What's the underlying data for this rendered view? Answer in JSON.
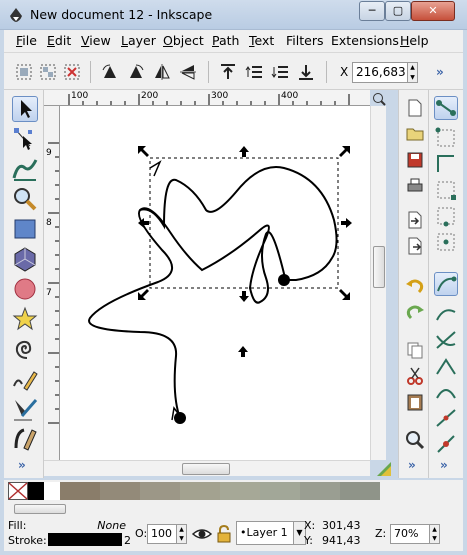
{
  "window": {
    "title": "New document 12 - Inkscape",
    "min_glyph": "─",
    "max_glyph": "▢",
    "close_glyph": "✕"
  },
  "menu": [
    {
      "key": "F",
      "rest": "ile"
    },
    {
      "key": "E",
      "rest": "dit"
    },
    {
      "key": "V",
      "rest": "iew"
    },
    {
      "key": "L",
      "rest": "ayer"
    },
    {
      "key": "O",
      "rest": "bject"
    },
    {
      "key": "P",
      "rest": "ath"
    },
    {
      "key": "T",
      "rest": "ext"
    },
    {
      "key": "F",
      "rest": "ilters",
      "key_first": false
    },
    {
      "key": "E",
      "rest": "xtensions",
      "key_first": false
    },
    {
      "key": "H",
      "rest": "elp"
    }
  ],
  "toolbar": {
    "x_label": "X",
    "x_value": "216,683",
    "spin_up": "▲",
    "spin_down": "▼",
    "more": "»"
  },
  "rulers": {
    "top": [
      "100",
      "200",
      "300",
      "400"
    ],
    "left": [
      "9",
      "8",
      "7"
    ]
  },
  "palette": {
    "colors": [
      "#000000",
      "#ffffff",
      "#8a7d6a",
      "#938a79",
      "#9c9787",
      "#a3a290",
      "#a6a897",
      "#a2a798",
      "#9a9e92",
      "#8f9489"
    ]
  },
  "status": {
    "fill_label": "Fill:",
    "fill_value": "None",
    "stroke_label": "Stroke:",
    "stroke_width": "2",
    "opacity_label": "O:",
    "opacity_value": "100",
    "layer_value": "•Layer 1",
    "layer_drop": "▼",
    "x_label": "X:",
    "x_value": "301,43",
    "y_label": "Y:",
    "y_value": "941,43",
    "zoom_label": "Z:",
    "zoom_value": "70%"
  },
  "colors": {
    "accent": "#3c64a8",
    "window_frame": "#c9d7e7",
    "panel": "#f0f0f0"
  },
  "icons": {
    "app": "inkscape-icon",
    "tools": [
      "selector-arrow-icon",
      "node-editor-icon",
      "tweak-icon",
      "zoom-icon",
      "rectangle-icon",
      "3d-box-icon",
      "ellipse-icon",
      "star-icon",
      "spiral-icon",
      "pencil-icon",
      "pen-icon",
      "calligraphy-icon"
    ]
  }
}
